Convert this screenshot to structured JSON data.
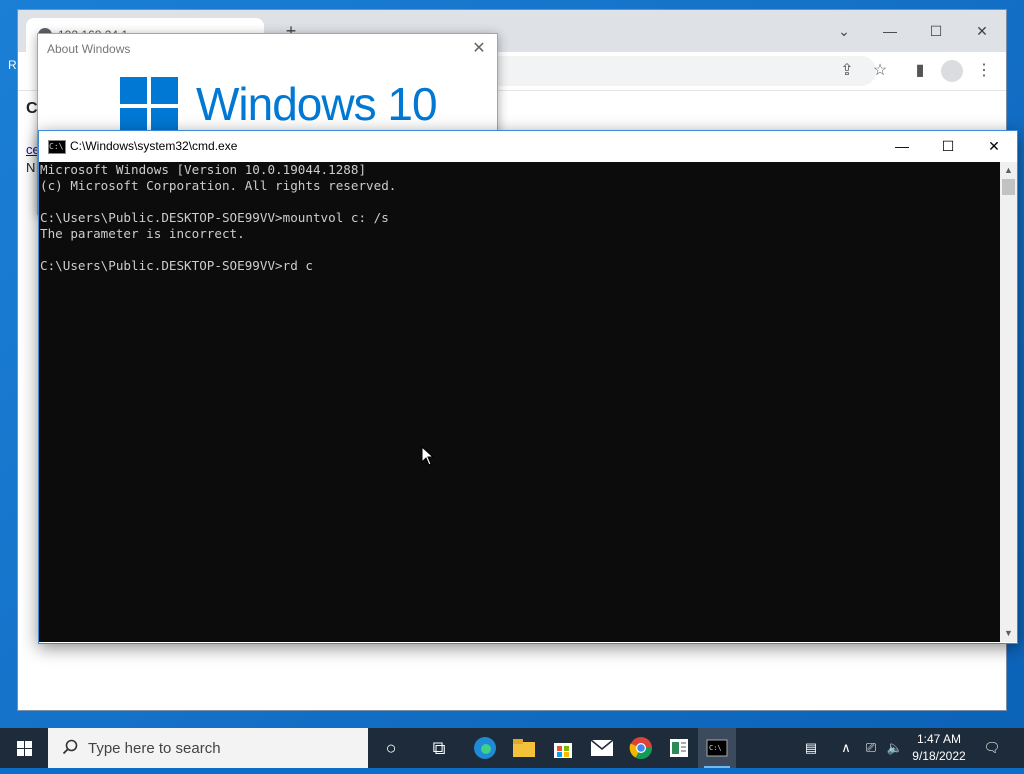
{
  "browser": {
    "tab_title": "192.168.24.1",
    "new_tab": "+",
    "page_fragments": [
      "C",
      "ce",
      "N",
      "ce"
    ],
    "desktop_fragment": "R"
  },
  "about": {
    "title": "About Windows",
    "wordmark": "Windows 10"
  },
  "cmd": {
    "title": "C:\\Windows\\system32\\cmd.exe",
    "lines": [
      "Microsoft Windows [Version 10.0.19044.1288]",
      "(c) Microsoft Corporation. All rights reserved.",
      "",
      "C:\\Users\\Public.DESKTOP-SOE99VV>mountvol c: /s",
      "The parameter is incorrect.",
      "",
      "C:\\Users\\Public.DESKTOP-SOE99VV>rd c"
    ]
  },
  "taskbar": {
    "search_placeholder": "Type here to search",
    "time": "1:47 AM",
    "date": "9/18/2022"
  },
  "colors": {
    "accent": "#0078d4",
    "console_bg": "#0c0c0c",
    "console_fg": "#cccccc",
    "taskbar": "#1e2b3a"
  }
}
